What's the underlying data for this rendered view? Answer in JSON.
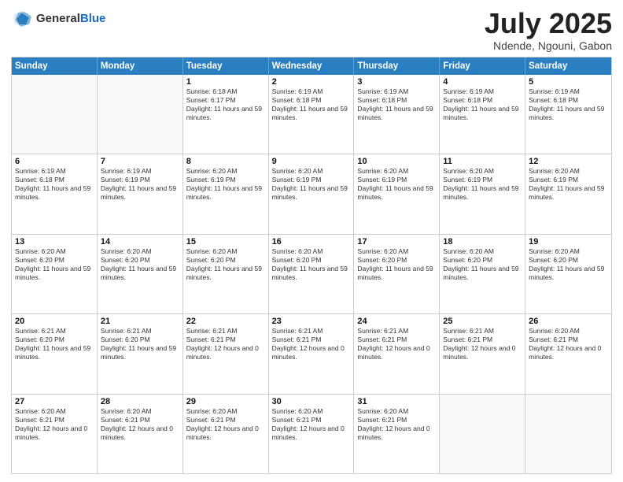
{
  "header": {
    "logo": {
      "general": "General",
      "blue": "Blue"
    },
    "title": "July 2025",
    "location": "Ndende, Ngouni, Gabon"
  },
  "weekdays": [
    "Sunday",
    "Monday",
    "Tuesday",
    "Wednesday",
    "Thursday",
    "Friday",
    "Saturday"
  ],
  "weeks": [
    [
      {
        "day": "",
        "info": ""
      },
      {
        "day": "",
        "info": ""
      },
      {
        "day": "1",
        "info": "Sunrise: 6:18 AM\nSunset: 6:17 PM\nDaylight: 11 hours and 59 minutes."
      },
      {
        "day": "2",
        "info": "Sunrise: 6:19 AM\nSunset: 6:18 PM\nDaylight: 11 hours and 59 minutes."
      },
      {
        "day": "3",
        "info": "Sunrise: 6:19 AM\nSunset: 6:18 PM\nDaylight: 11 hours and 59 minutes."
      },
      {
        "day": "4",
        "info": "Sunrise: 6:19 AM\nSunset: 6:18 PM\nDaylight: 11 hours and 59 minutes."
      },
      {
        "day": "5",
        "info": "Sunrise: 6:19 AM\nSunset: 6:18 PM\nDaylight: 11 hours and 59 minutes."
      }
    ],
    [
      {
        "day": "6",
        "info": "Sunrise: 6:19 AM\nSunset: 6:18 PM\nDaylight: 11 hours and 59 minutes."
      },
      {
        "day": "7",
        "info": "Sunrise: 6:19 AM\nSunset: 6:19 PM\nDaylight: 11 hours and 59 minutes."
      },
      {
        "day": "8",
        "info": "Sunrise: 6:20 AM\nSunset: 6:19 PM\nDaylight: 11 hours and 59 minutes."
      },
      {
        "day": "9",
        "info": "Sunrise: 6:20 AM\nSunset: 6:19 PM\nDaylight: 11 hours and 59 minutes."
      },
      {
        "day": "10",
        "info": "Sunrise: 6:20 AM\nSunset: 6:19 PM\nDaylight: 11 hours and 59 minutes."
      },
      {
        "day": "11",
        "info": "Sunrise: 6:20 AM\nSunset: 6:19 PM\nDaylight: 11 hours and 59 minutes."
      },
      {
        "day": "12",
        "info": "Sunrise: 6:20 AM\nSunset: 6:19 PM\nDaylight: 11 hours and 59 minutes."
      }
    ],
    [
      {
        "day": "13",
        "info": "Sunrise: 6:20 AM\nSunset: 6:20 PM\nDaylight: 11 hours and 59 minutes."
      },
      {
        "day": "14",
        "info": "Sunrise: 6:20 AM\nSunset: 6:20 PM\nDaylight: 11 hours and 59 minutes."
      },
      {
        "day": "15",
        "info": "Sunrise: 6:20 AM\nSunset: 6:20 PM\nDaylight: 11 hours and 59 minutes."
      },
      {
        "day": "16",
        "info": "Sunrise: 6:20 AM\nSunset: 6:20 PM\nDaylight: 11 hours and 59 minutes."
      },
      {
        "day": "17",
        "info": "Sunrise: 6:20 AM\nSunset: 6:20 PM\nDaylight: 11 hours and 59 minutes."
      },
      {
        "day": "18",
        "info": "Sunrise: 6:20 AM\nSunset: 6:20 PM\nDaylight: 11 hours and 59 minutes."
      },
      {
        "day": "19",
        "info": "Sunrise: 6:20 AM\nSunset: 6:20 PM\nDaylight: 11 hours and 59 minutes."
      }
    ],
    [
      {
        "day": "20",
        "info": "Sunrise: 6:21 AM\nSunset: 6:20 PM\nDaylight: 11 hours and 59 minutes."
      },
      {
        "day": "21",
        "info": "Sunrise: 6:21 AM\nSunset: 6:20 PM\nDaylight: 11 hours and 59 minutes."
      },
      {
        "day": "22",
        "info": "Sunrise: 6:21 AM\nSunset: 6:21 PM\nDaylight: 12 hours and 0 minutes."
      },
      {
        "day": "23",
        "info": "Sunrise: 6:21 AM\nSunset: 6:21 PM\nDaylight: 12 hours and 0 minutes."
      },
      {
        "day": "24",
        "info": "Sunrise: 6:21 AM\nSunset: 6:21 PM\nDaylight: 12 hours and 0 minutes."
      },
      {
        "day": "25",
        "info": "Sunrise: 6:21 AM\nSunset: 6:21 PM\nDaylight: 12 hours and 0 minutes."
      },
      {
        "day": "26",
        "info": "Sunrise: 6:20 AM\nSunset: 6:21 PM\nDaylight: 12 hours and 0 minutes."
      }
    ],
    [
      {
        "day": "27",
        "info": "Sunrise: 6:20 AM\nSunset: 6:21 PM\nDaylight: 12 hours and 0 minutes."
      },
      {
        "day": "28",
        "info": "Sunrise: 6:20 AM\nSunset: 6:21 PM\nDaylight: 12 hours and 0 minutes."
      },
      {
        "day": "29",
        "info": "Sunrise: 6:20 AM\nSunset: 6:21 PM\nDaylight: 12 hours and 0 minutes."
      },
      {
        "day": "30",
        "info": "Sunrise: 6:20 AM\nSunset: 6:21 PM\nDaylight: 12 hours and 0 minutes."
      },
      {
        "day": "31",
        "info": "Sunrise: 6:20 AM\nSunset: 6:21 PM\nDaylight: 12 hours and 0 minutes."
      },
      {
        "day": "",
        "info": ""
      },
      {
        "day": "",
        "info": ""
      }
    ]
  ]
}
